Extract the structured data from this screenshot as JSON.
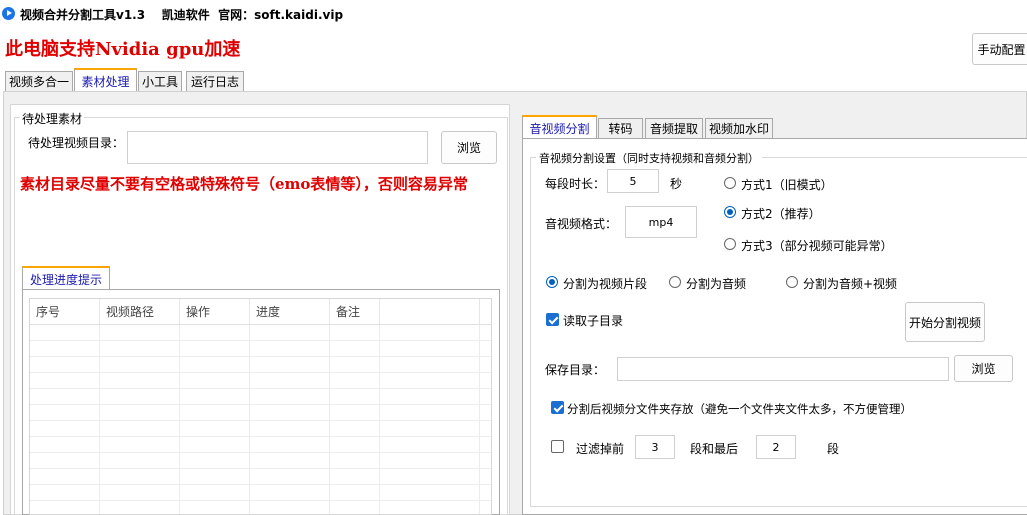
{
  "window": {
    "title": "视频合并分割工具v1.3    凯迪软件  官网：soft.kaidi.vip"
  },
  "banner": "此电脑支持Nvidia gpu加速",
  "manual_button": "手动配置",
  "main_tabs": [
    {
      "label": "视频多合一"
    },
    {
      "label": "素材处理"
    },
    {
      "label": "小工具"
    },
    {
      "label": "运行日志"
    }
  ],
  "left": {
    "group_title": "待处理素材",
    "dir_label": "待处理视频目录：",
    "dir_value": "",
    "browse": "浏览",
    "warning": "素材目录尽量不要有空格或特殊符号（emo表情等），否则容易异常",
    "progress_tab": "处理进度提示",
    "columns": [
      "序号",
      "视频路径",
      "操作",
      "进度",
      "备注"
    ]
  },
  "right": {
    "tabs": [
      {
        "label": "音视频分割"
      },
      {
        "label": "转码"
      },
      {
        "label": "音频提取"
      },
      {
        "label": "视频加水印"
      }
    ],
    "group_title": "音视频分割设置（同时支持视频和音频分割）",
    "segment_label": "每段时长：",
    "segment_value": "5",
    "segment_unit": "秒",
    "format_label": "音视频格式：",
    "format_value": "mp4",
    "modes": [
      {
        "label": "方式1（旧模式）",
        "selected": false
      },
      {
        "label": "方式2（推荐）",
        "selected": true
      },
      {
        "label": "方式3（部分视频可能异常）",
        "selected": false
      }
    ],
    "split_types": [
      {
        "label": "分割为视频片段",
        "selected": true
      },
      {
        "label": "分割为音频",
        "selected": false
      },
      {
        "label": "分割为音频+视频",
        "selected": false
      }
    ],
    "read_subdir": {
      "label": "读取子目录",
      "checked": true
    },
    "start_button": "开始分割视频",
    "save_label": "保存目录：",
    "save_value": "",
    "browse": "浏览",
    "folder_option": {
      "label": "分割后视频分文件夹存放（避免一个文件夹文件太多，不方便管理）",
      "checked": true
    },
    "filter": {
      "checked": false,
      "label_pre": "过滤掉前",
      "first": "3",
      "label_mid": "段和最后",
      "last": "2",
      "label_post": "段"
    }
  },
  "colors": {
    "warning": "#e00000",
    "accent": "#0060c0",
    "tab_highlight": "#ffa500"
  }
}
